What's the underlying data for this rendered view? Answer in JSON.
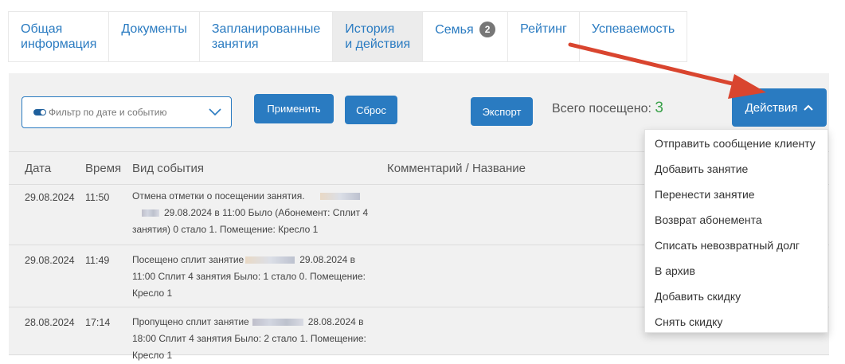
{
  "tabs": [
    {
      "label_line1": "Общая",
      "label_line2": "информация",
      "active": false
    },
    {
      "label_line1": "Документы",
      "label_line2": "",
      "active": false
    },
    {
      "label_line1": "Запланированные",
      "label_line2": "занятия",
      "active": false
    },
    {
      "label_line1": "История",
      "label_line2": "и действия",
      "active": true
    },
    {
      "label_line1": "Семья",
      "label_line2": "",
      "badge": "2",
      "active": false
    },
    {
      "label_line1": "Рейтинг",
      "label_line2": "",
      "active": false
    },
    {
      "label_line1": "Успеваемость",
      "label_line2": "",
      "active": false
    }
  ],
  "filter": {
    "placeholder": "Фильтр по дате и событию",
    "apply_label": "Применить",
    "reset_label": "Сброс",
    "export_label": "Экспорт",
    "visits_label": "Всего посещено:",
    "visits_count": "3",
    "actions_label": "Действия"
  },
  "table": {
    "headers": {
      "date": "Дата",
      "time": "Время",
      "event": "Вид события",
      "comment": "Комментарий / Название"
    },
    "rows": [
      {
        "date": "29.08.2024",
        "time": "11:50",
        "event_a": "Отмена отметки о посещении занятия.",
        "event_b": "29.08.2024 в 11:00 Было (Абонемент: Сплит 4",
        "event_c": "занятия) 0 стало 1. Помещение: Кресло 1"
      },
      {
        "date": "29.08.2024",
        "time": "11:49",
        "event_a": "Посещено сплит занятие",
        "event_a2": "29.08.2024 в",
        "event_b": "11:00 Сплит 4 занятия Было: 1 стало 0. Помещение:",
        "event_c": "Кресло 1"
      },
      {
        "date": "28.08.2024",
        "time": "17:14",
        "event_a": "Пропущено сплит занятие",
        "event_a2": "28.08.2024 в",
        "event_b": "18:00 Сплит 4 занятия Было: 2 стало 1. Помещение:",
        "event_c": "Кресло 1"
      }
    ]
  },
  "actions_menu": [
    "Отправить сообщение клиенту",
    "Добавить занятие",
    "Перенести занятие",
    "Возврат абонемента",
    "Списать невозвратный долг",
    "В архив",
    "Добавить скидку",
    "Снять скидку"
  ],
  "colors": {
    "accent": "#2a7bc1",
    "visits_count": "#3aa14a",
    "annotation_arrow": "#d9452f"
  }
}
